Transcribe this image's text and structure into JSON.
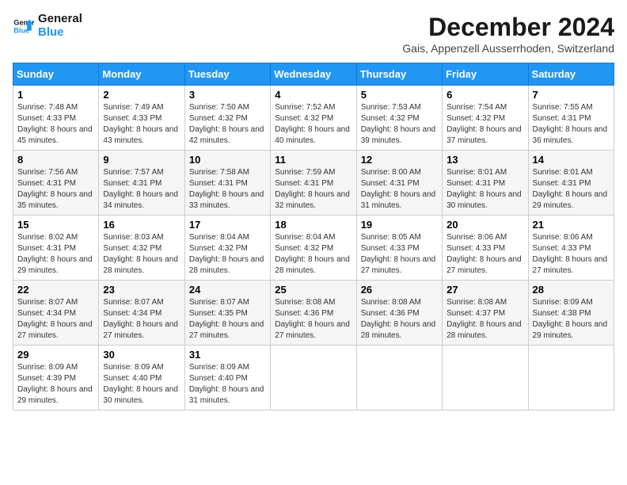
{
  "logo": {
    "line1": "General",
    "line2": "Blue"
  },
  "title": "December 2024",
  "subtitle": "Gais, Appenzell Ausserrhoden, Switzerland",
  "weekdays": [
    "Sunday",
    "Monday",
    "Tuesday",
    "Wednesday",
    "Thursday",
    "Friday",
    "Saturday"
  ],
  "weeks": [
    [
      {
        "day": "1",
        "sunrise": "Sunrise: 7:48 AM",
        "sunset": "Sunset: 4:33 PM",
        "daylight": "Daylight: 8 hours and 45 minutes."
      },
      {
        "day": "2",
        "sunrise": "Sunrise: 7:49 AM",
        "sunset": "Sunset: 4:33 PM",
        "daylight": "Daylight: 8 hours and 43 minutes."
      },
      {
        "day": "3",
        "sunrise": "Sunrise: 7:50 AM",
        "sunset": "Sunset: 4:32 PM",
        "daylight": "Daylight: 8 hours and 42 minutes."
      },
      {
        "day": "4",
        "sunrise": "Sunrise: 7:52 AM",
        "sunset": "Sunset: 4:32 PM",
        "daylight": "Daylight: 8 hours and 40 minutes."
      },
      {
        "day": "5",
        "sunrise": "Sunrise: 7:53 AM",
        "sunset": "Sunset: 4:32 PM",
        "daylight": "Daylight: 8 hours and 39 minutes."
      },
      {
        "day": "6",
        "sunrise": "Sunrise: 7:54 AM",
        "sunset": "Sunset: 4:32 PM",
        "daylight": "Daylight: 8 hours and 37 minutes."
      },
      {
        "day": "7",
        "sunrise": "Sunrise: 7:55 AM",
        "sunset": "Sunset: 4:31 PM",
        "daylight": "Daylight: 8 hours and 36 minutes."
      }
    ],
    [
      {
        "day": "8",
        "sunrise": "Sunrise: 7:56 AM",
        "sunset": "Sunset: 4:31 PM",
        "daylight": "Daylight: 8 hours and 35 minutes."
      },
      {
        "day": "9",
        "sunrise": "Sunrise: 7:57 AM",
        "sunset": "Sunset: 4:31 PM",
        "daylight": "Daylight: 8 hours and 34 minutes."
      },
      {
        "day": "10",
        "sunrise": "Sunrise: 7:58 AM",
        "sunset": "Sunset: 4:31 PM",
        "daylight": "Daylight: 8 hours and 33 minutes."
      },
      {
        "day": "11",
        "sunrise": "Sunrise: 7:59 AM",
        "sunset": "Sunset: 4:31 PM",
        "daylight": "Daylight: 8 hours and 32 minutes."
      },
      {
        "day": "12",
        "sunrise": "Sunrise: 8:00 AM",
        "sunset": "Sunset: 4:31 PM",
        "daylight": "Daylight: 8 hours and 31 minutes."
      },
      {
        "day": "13",
        "sunrise": "Sunrise: 8:01 AM",
        "sunset": "Sunset: 4:31 PM",
        "daylight": "Daylight: 8 hours and 30 minutes."
      },
      {
        "day": "14",
        "sunrise": "Sunrise: 8:01 AM",
        "sunset": "Sunset: 4:31 PM",
        "daylight": "Daylight: 8 hours and 29 minutes."
      }
    ],
    [
      {
        "day": "15",
        "sunrise": "Sunrise: 8:02 AM",
        "sunset": "Sunset: 4:31 PM",
        "daylight": "Daylight: 8 hours and 29 minutes."
      },
      {
        "day": "16",
        "sunrise": "Sunrise: 8:03 AM",
        "sunset": "Sunset: 4:32 PM",
        "daylight": "Daylight: 8 hours and 28 minutes."
      },
      {
        "day": "17",
        "sunrise": "Sunrise: 8:04 AM",
        "sunset": "Sunset: 4:32 PM",
        "daylight": "Daylight: 8 hours and 28 minutes."
      },
      {
        "day": "18",
        "sunrise": "Sunrise: 8:04 AM",
        "sunset": "Sunset: 4:32 PM",
        "daylight": "Daylight: 8 hours and 28 minutes."
      },
      {
        "day": "19",
        "sunrise": "Sunrise: 8:05 AM",
        "sunset": "Sunset: 4:33 PM",
        "daylight": "Daylight: 8 hours and 27 minutes."
      },
      {
        "day": "20",
        "sunrise": "Sunrise: 8:06 AM",
        "sunset": "Sunset: 4:33 PM",
        "daylight": "Daylight: 8 hours and 27 minutes."
      },
      {
        "day": "21",
        "sunrise": "Sunrise: 8:06 AM",
        "sunset": "Sunset: 4:33 PM",
        "daylight": "Daylight: 8 hours and 27 minutes."
      }
    ],
    [
      {
        "day": "22",
        "sunrise": "Sunrise: 8:07 AM",
        "sunset": "Sunset: 4:34 PM",
        "daylight": "Daylight: 8 hours and 27 minutes."
      },
      {
        "day": "23",
        "sunrise": "Sunrise: 8:07 AM",
        "sunset": "Sunset: 4:34 PM",
        "daylight": "Daylight: 8 hours and 27 minutes."
      },
      {
        "day": "24",
        "sunrise": "Sunrise: 8:07 AM",
        "sunset": "Sunset: 4:35 PM",
        "daylight": "Daylight: 8 hours and 27 minutes."
      },
      {
        "day": "25",
        "sunrise": "Sunrise: 8:08 AM",
        "sunset": "Sunset: 4:36 PM",
        "daylight": "Daylight: 8 hours and 27 minutes."
      },
      {
        "day": "26",
        "sunrise": "Sunrise: 8:08 AM",
        "sunset": "Sunset: 4:36 PM",
        "daylight": "Daylight: 8 hours and 28 minutes."
      },
      {
        "day": "27",
        "sunrise": "Sunrise: 8:08 AM",
        "sunset": "Sunset: 4:37 PM",
        "daylight": "Daylight: 8 hours and 28 minutes."
      },
      {
        "day": "28",
        "sunrise": "Sunrise: 8:09 AM",
        "sunset": "Sunset: 4:38 PM",
        "daylight": "Daylight: 8 hours and 29 minutes."
      }
    ],
    [
      {
        "day": "29",
        "sunrise": "Sunrise: 8:09 AM",
        "sunset": "Sunset: 4:39 PM",
        "daylight": "Daylight: 8 hours and 29 minutes."
      },
      {
        "day": "30",
        "sunrise": "Sunrise: 8:09 AM",
        "sunset": "Sunset: 4:40 PM",
        "daylight": "Daylight: 8 hours and 30 minutes."
      },
      {
        "day": "31",
        "sunrise": "Sunrise: 8:09 AM",
        "sunset": "Sunset: 4:40 PM",
        "daylight": "Daylight: 8 hours and 31 minutes."
      },
      null,
      null,
      null,
      null
    ]
  ]
}
